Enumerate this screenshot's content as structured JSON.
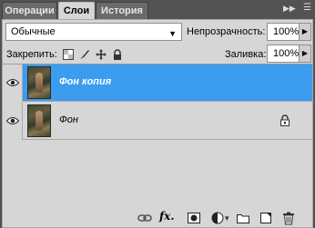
{
  "tabs": [
    {
      "label": "Операции",
      "active": false
    },
    {
      "label": "Слои",
      "active": true
    },
    {
      "label": "История",
      "active": false
    }
  ],
  "blend_mode": {
    "value": "Обычные"
  },
  "opacity": {
    "label": "Непрозрачность:",
    "value": "100%"
  },
  "lock": {
    "label": "Закрепить:"
  },
  "fill": {
    "label": "Заливка:",
    "value": "100%"
  },
  "layers": [
    {
      "name": "Фон копия",
      "selected": true,
      "visible": true,
      "locked": false
    },
    {
      "name": "Фон",
      "selected": false,
      "visible": true,
      "locked": true
    }
  ],
  "colors": {
    "selection": "#3b9cf0",
    "panel": "#d6d6d6",
    "frame": "#535353"
  },
  "icons": [
    "eye-icon",
    "lock-icon",
    "link-layers-icon",
    "fx-icon",
    "layer-mask-icon",
    "adjustment-layer-icon",
    "group-folder-icon",
    "new-layer-icon",
    "trash-icon"
  ]
}
